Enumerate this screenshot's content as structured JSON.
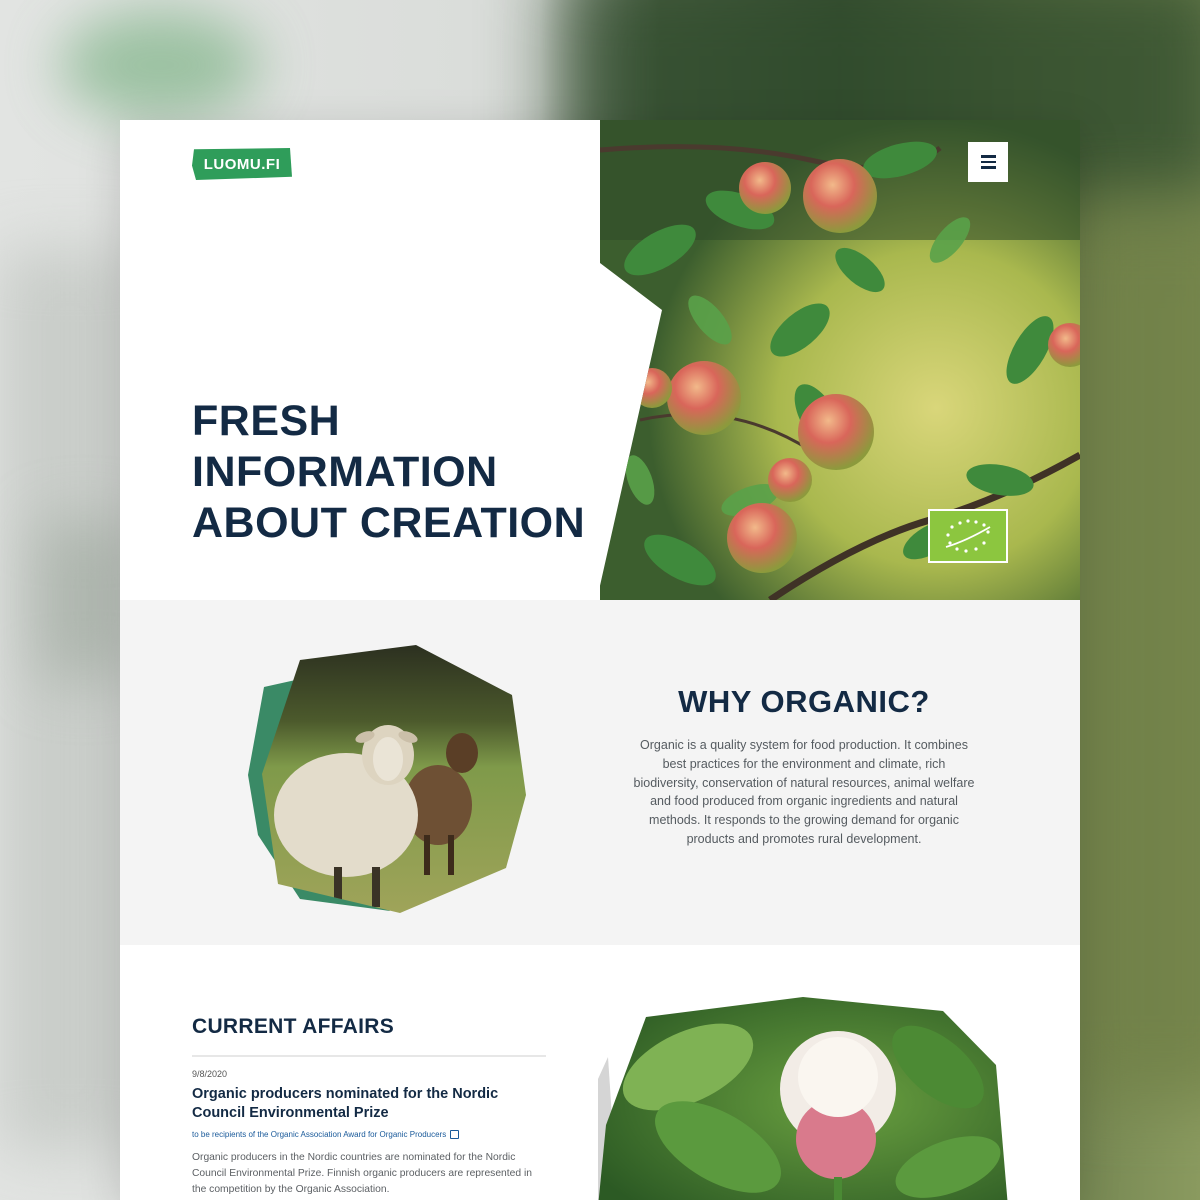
{
  "header": {
    "logo_text": "LUOMU.FI",
    "menu_icon": "hamburger-icon",
    "brand_color": "#2f9d5a"
  },
  "hero": {
    "title": "FRESH INFORMATION ABOUT CREATION",
    "badge_icon": "eu-organic-leaf-icon"
  },
  "why": {
    "heading": "WHY ORGANIC?",
    "text": "Organic is a quality system for food production. It combines best practices for the environment and climate, rich biodiversity, conservation of natural resources, animal welfare and food produced from organic ingredients and natural methods. It responds to the growing demand for organic products and promotes rural development."
  },
  "news": {
    "heading": "CURRENT AFFAIRS",
    "items": [
      {
        "date": "9/8/2020",
        "title": "Organic producers nominated for the Nordic Council Environmental Prize",
        "link": "to be recipients of the Organic Association Award for Organic Producers",
        "excerpt": "Organic producers in the Nordic countries are nominated for the Nordic Council Environmental Prize. Finnish organic producers are represented in the competition by the Organic Association."
      }
    ]
  },
  "colors": {
    "heading": "#132a44",
    "section_bg": "#f4f4f4",
    "eu_badge": "#8cc63f"
  }
}
